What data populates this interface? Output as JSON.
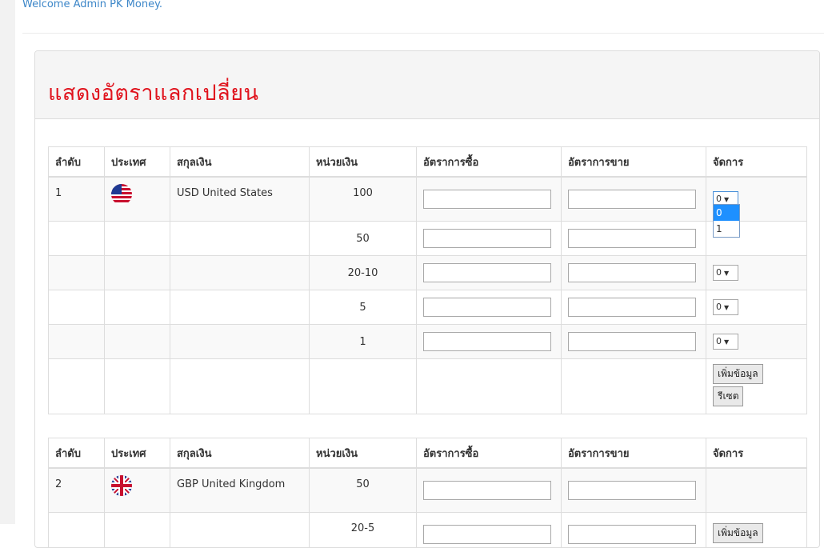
{
  "welcome": "Welcome Admin PK Money.",
  "title": "แสดงอัตราแลกเปลี่ยน",
  "columns": [
    "ลำดับ",
    "ประเทศ",
    "สกุลเงิน",
    "หน่วยเงิน",
    "อัตราการซื้อ",
    "อัตราการขาย",
    "จัดการ"
  ],
  "usd": {
    "no": "1",
    "flag": "us-flag-icon",
    "currency": "USD United States",
    "units": [
      "100",
      "50",
      "20-10",
      "5",
      "1"
    ],
    "select_value": "0",
    "dropdown_options": [
      "0",
      "1"
    ],
    "add_button": "เพิ่มข้อมูล",
    "reset_button": "รีเซต"
  },
  "gbp": {
    "no": "2",
    "flag": "uk-flag-icon",
    "currency": "GBP United Kingdom",
    "units": [
      "50",
      "20-5"
    ],
    "add_button": "เพิ่มข้อมูล"
  },
  "colors": {
    "title": "#e0141e",
    "link": "#3c86c8",
    "dropdown_highlight": "#1e90ff"
  }
}
